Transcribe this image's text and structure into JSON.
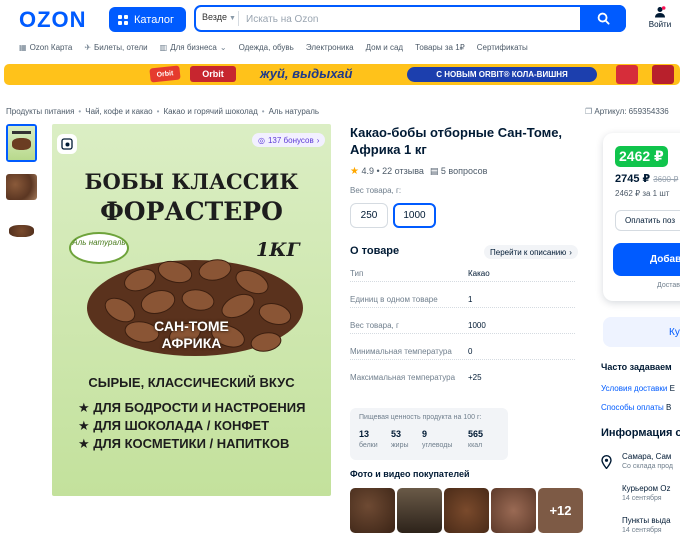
{
  "header": {
    "logo": "OZON",
    "catalog_label": "Каталог",
    "search_scope": "Везде",
    "search_placeholder": "Искать на Ozon",
    "login_label": "Войти"
  },
  "nav": [
    {
      "icon": "grid-icon",
      "label": "Ozon Карта"
    },
    {
      "icon": "plane-icon",
      "label": "Билеты, отели"
    },
    {
      "icon": "building-icon",
      "label": "Для бизнеса"
    },
    {
      "label": "Одежда, обувь"
    },
    {
      "label": "Электроника"
    },
    {
      "label": "Дом и сад"
    },
    {
      "label": "Товары за 1₽"
    },
    {
      "label": "Сертификаты"
    }
  ],
  "banner": {
    "brand": "Orbit",
    "slogan": "жуй, выдыхай",
    "pill": "С НОВЫМ ORBIT® КОЛА-ВИШНЯ",
    "bg_color": "#ffc21a"
  },
  "breadcrumb": [
    "Продукты питания",
    "Чай, кофе и какао",
    "Какао и горячий шоколад",
    "Аль натураль"
  ],
  "article": "Артикул: 659354336",
  "image": {
    "bonus": "137 бонусов",
    "title1": "БОБЫ КЛАССИК",
    "title2": "ФОРАСТЕРО",
    "weight": "1КГ",
    "brand": "Аль натураль",
    "origin1": "САН-ТОМЕ",
    "origin2": "АФРИКА",
    "caption": "СЫРЫЕ, КЛАССИЧЕСКИЙ ВКУС",
    "list": [
      "★ ДЛЯ БОДРОСТИ И НАСТРОЕНИЯ",
      "★ ДЛЯ ШОКОЛАДА / КОНФЕТ",
      "★ ДЛЯ КОСМЕТИКИ / НАПИТКОВ"
    ]
  },
  "product": {
    "title": "Какао-бобы отборные Сан-Томе, Африка 1 кг",
    "rating": "4.9",
    "reviews": "22 отзыва",
    "questions": "5 вопросов",
    "weight_label": "Вес товара, г:",
    "weight_options": [
      "250",
      "1000"
    ],
    "weight_selected": "1000",
    "about_title": "О товаре",
    "goto_label": "Перейти к описанию",
    "specs": [
      {
        "k": "Тип",
        "v": "Какао"
      },
      {
        "k": "Единиц в одном товаре",
        "v": "1"
      },
      {
        "k": "Вес товара, г",
        "v": "1000"
      },
      {
        "k": "Минимальная температура",
        "v": "0"
      },
      {
        "k": "Максимальная температура",
        "v": "+25"
      }
    ],
    "nutrition_title": "Пищевая ценность продукта на 100 г:",
    "nutrition": [
      {
        "n": "13",
        "l": "белки"
      },
      {
        "n": "53",
        "l": "жиры"
      },
      {
        "n": "9",
        "l": "углеводы"
      },
      {
        "n": "565",
        "l": "ккал"
      }
    ],
    "photos_title": "Фото и видео покупателей",
    "photos_more": "+12"
  },
  "buy": {
    "price_card": "2462 ₽",
    "price_full": "2745 ₽",
    "price_old": "3600 ₽",
    "price_unit": "2462 ₽ за 1 шт",
    "pay_label": "Оплатить поз",
    "add_label": "Добав",
    "delivery": "Достав",
    "buy_label": "Ку"
  },
  "faq": {
    "title": "Часто задаваем",
    "links": [
      "Условия доставки",
      "Способы оплаты"
    ]
  },
  "info": {
    "title": "Информация о",
    "locations": [
      {
        "t": "Самара, Сам",
        "s": "Со склада прод"
      },
      {
        "t": "Курьером Oz",
        "s": "14 сентября"
      },
      {
        "t": "Пункты выда",
        "s": "14 сентября"
      }
    ]
  }
}
